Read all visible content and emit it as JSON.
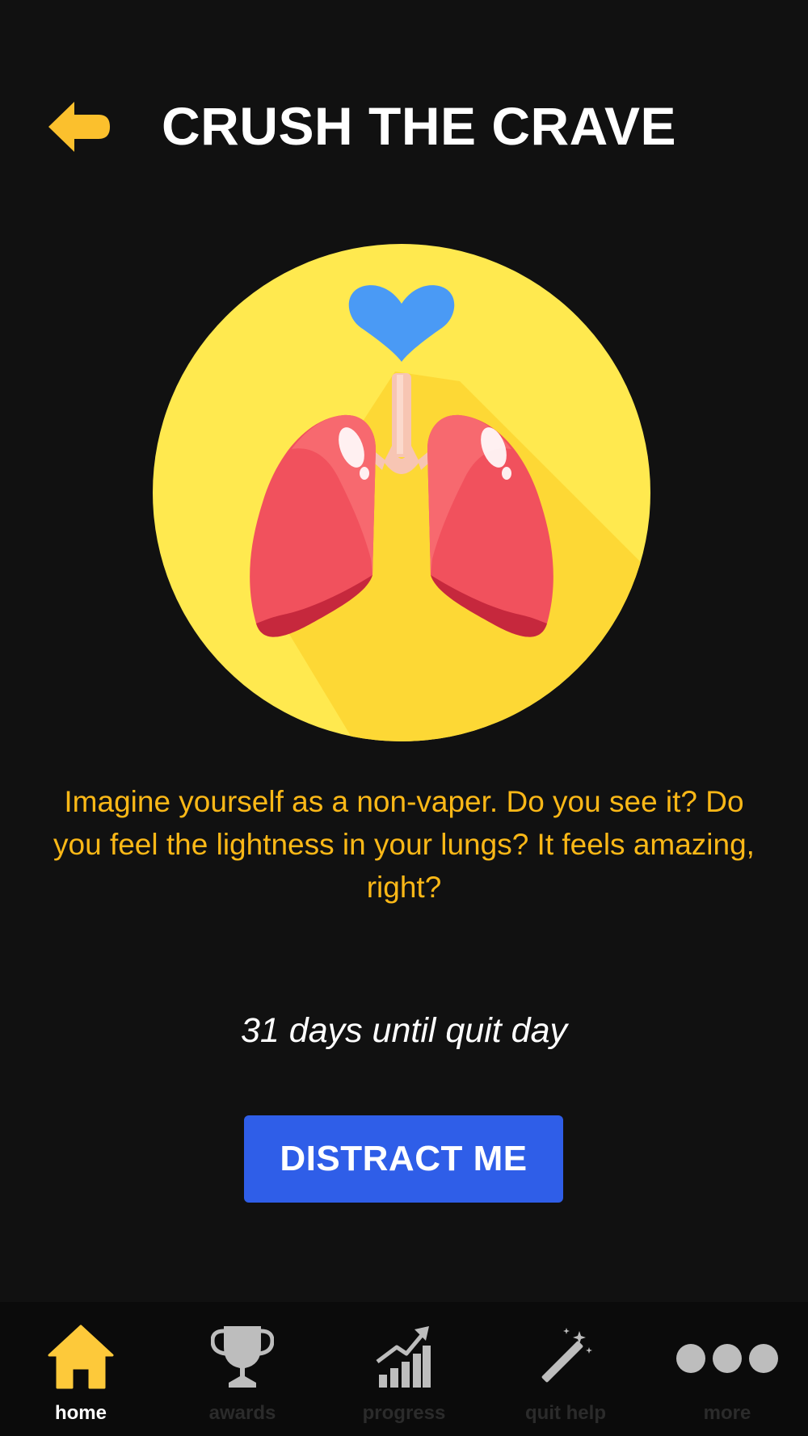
{
  "header": {
    "title": "CRUSH THE CRAVE",
    "back_icon": "back-arrow-icon"
  },
  "illustration": {
    "icon": "lungs-heart-icon",
    "colors": {
      "circle": "#ffe94f",
      "shadow": "#fdd835",
      "heart": "#4a9af5",
      "lungs": "#f1515d"
    }
  },
  "motivation": {
    "text": "Imagine yourself as a non-vaper. Do you see it? Do you feel the lightness in your lungs? It feels amazing, right?"
  },
  "countdown": {
    "text": "31 days until quit day"
  },
  "action": {
    "distract_label": "DISTRACT ME"
  },
  "nav": {
    "items": [
      {
        "label": "home",
        "icon": "home-icon",
        "active": true
      },
      {
        "label": "awards",
        "icon": "trophy-icon",
        "active": false
      },
      {
        "label": "progress",
        "icon": "chart-icon",
        "active": false
      },
      {
        "label": "quit help",
        "icon": "magic-wand-icon",
        "active": false
      },
      {
        "label": "more",
        "icon": "more-dots-icon",
        "active": false
      }
    ]
  },
  "colors": {
    "background": "#111111",
    "accent": "#fbb817",
    "title": "#ffffff",
    "button": "#2f5ee8",
    "nav_active": "#fdc93a",
    "nav_inactive": "#bdbdbd"
  }
}
